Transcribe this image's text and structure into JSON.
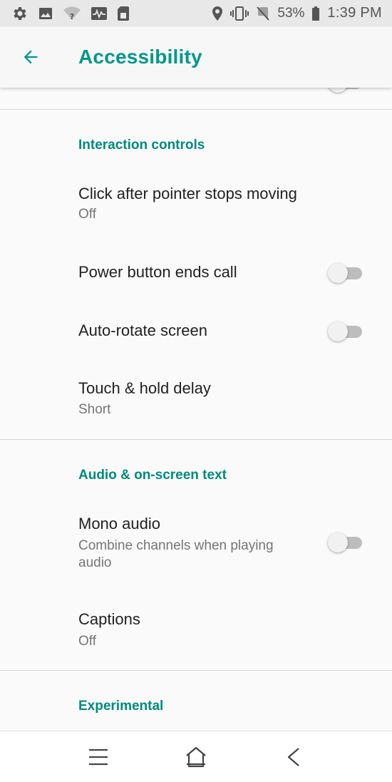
{
  "status_bar": {
    "battery_percent": "53%",
    "time": "1:39 PM",
    "icons_left": [
      "gear-icon",
      "image-icon",
      "wifi-question-icon",
      "activity-icon",
      "sim-card-icon"
    ],
    "icons_right": [
      "location-pin-icon",
      "vibrate-icon",
      "no-sim-icon",
      "battery-icon"
    ]
  },
  "app_bar": {
    "title": "Accessibility",
    "back_icon": "arrow-back-icon",
    "accent_color": "#009688"
  },
  "sections": [
    {
      "header": "Interaction controls",
      "items": [
        {
          "title": "Click after pointer stops moving",
          "summary": "Off"
        },
        {
          "title": "Power button ends call",
          "toggle": false
        },
        {
          "title": "Auto-rotate screen",
          "toggle": false
        },
        {
          "title": "Touch & hold delay",
          "summary": "Short"
        }
      ]
    },
    {
      "header": "Audio & on-screen text",
      "items": [
        {
          "title": "Mono audio",
          "summary": "Combine channels when playing audio",
          "toggle": false
        },
        {
          "title": "Captions",
          "summary": "Off"
        }
      ]
    },
    {
      "header": "Experimental",
      "items": []
    }
  ],
  "nav_bar": {
    "icons": [
      "menu-icon",
      "home-icon",
      "back-chevron-icon"
    ]
  }
}
